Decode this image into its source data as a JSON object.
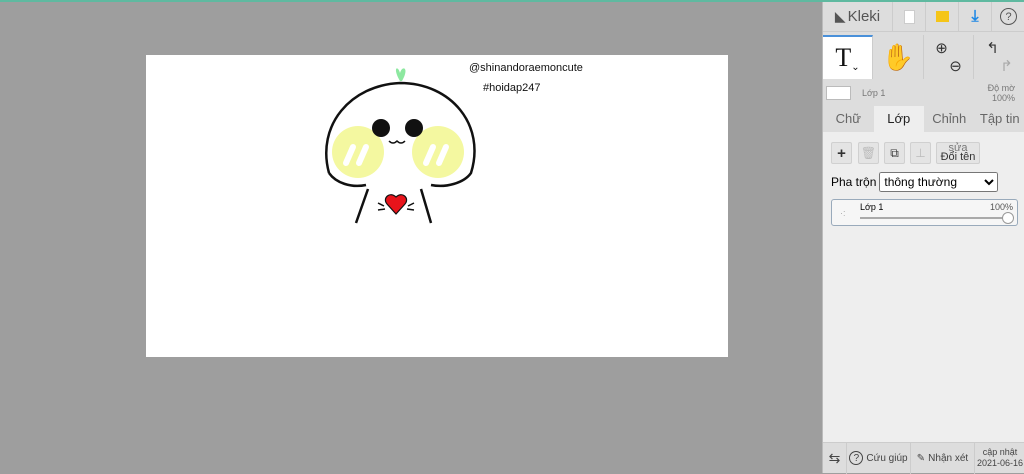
{
  "canvas": {
    "text1": "@shinandoraemoncute",
    "text2": "#hoidap247"
  },
  "header": {
    "logo": "Kleki"
  },
  "tools": {
    "text_tool": "T"
  },
  "layer_info": {
    "name": "Lớp 1",
    "opacity_label": "Độ mờ",
    "opacity_value": "100%"
  },
  "tabs": [
    {
      "label": "Chữ"
    },
    {
      "label": "Lớp"
    },
    {
      "label": "Chỉnh"
    },
    {
      "label": "Tập tin"
    }
  ],
  "layers_panel": {
    "add": "+",
    "rename_top": "sửa",
    "rename": "Đổi tên",
    "blend_label": "Pha trộn",
    "blend_value": "thông thường",
    "layer": {
      "name": "Lớp 1",
      "opacity": "100%",
      "opacity_fraction": 1.0
    }
  },
  "footer": {
    "help": "Cứu giúp",
    "feedback": "Nhận xét",
    "update_label": "cập nhật",
    "update_date": "2021-06-16"
  },
  "colors": {
    "accent": "#1e88e5",
    "folder": "#f5c518",
    "cheek": "#f4f8a0",
    "heart": "#e8141b",
    "sprout": "#8de8a0"
  }
}
